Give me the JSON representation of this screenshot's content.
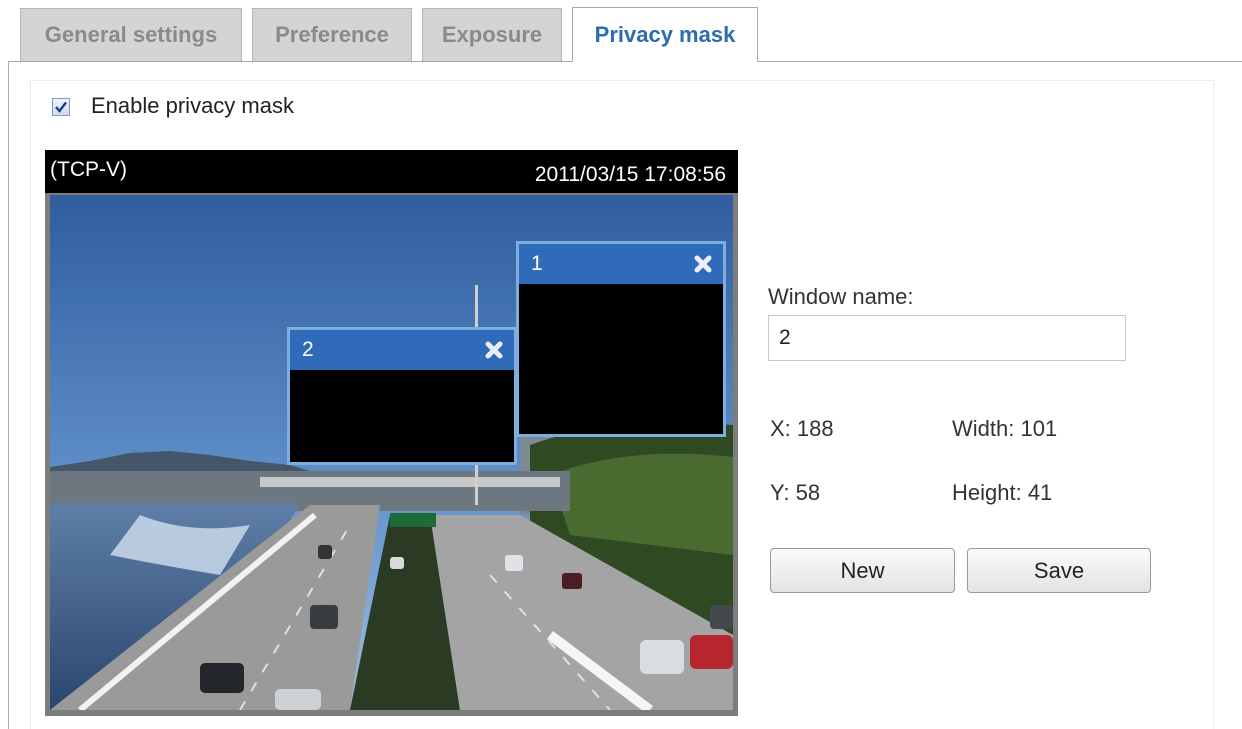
{
  "tabs": [
    {
      "label": "General settings",
      "active": false
    },
    {
      "label": "Preference",
      "active": false
    },
    {
      "label": "Exposure",
      "active": false
    },
    {
      "label": "Privacy mask",
      "active": true
    }
  ],
  "enable_privacy_mask": {
    "label": "Enable privacy mask",
    "checked": true
  },
  "video": {
    "name": "(TCP-V)",
    "timestamp": "2011/03/15  17:08:56"
  },
  "masks": [
    {
      "number": "1"
    },
    {
      "number": "2"
    }
  ],
  "form": {
    "window_name_label": "Window name:",
    "window_name_value": "2",
    "x_label": "X: 188",
    "y_label": "Y: 58",
    "width_label": "Width: 101",
    "height_label": "Height: 41",
    "new_button": "New",
    "save_button": "Save"
  },
  "colors": {
    "accent": "#2e6bb0",
    "mask_header": "#2f6bb8",
    "mask_border": "#7eaee0"
  }
}
